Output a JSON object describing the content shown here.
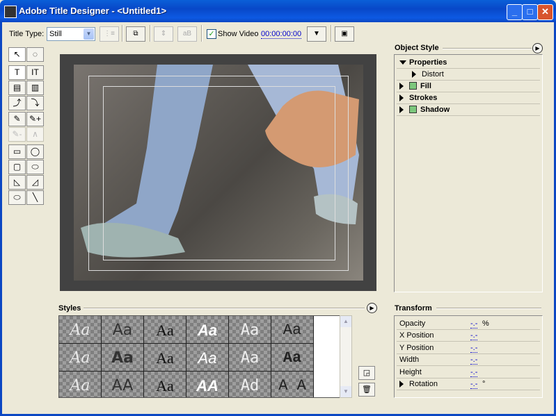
{
  "window": {
    "title": "Adobe Title Designer - <Untitled1>",
    "minimize": "_",
    "maximize": "□",
    "close": "✕"
  },
  "toolbar": {
    "title_type_label": "Title Type:",
    "title_type_value": "Still",
    "show_video_label": "Show Video",
    "show_video_checked": true,
    "timecode": "00:00:00:00"
  },
  "tools": [
    "↖",
    "◌",
    "T",
    "IT",
    "▤",
    "▥",
    "⤴",
    "⤵",
    "✎",
    "✎+",
    "✎-",
    "∧",
    "▭",
    "◯",
    "▢",
    "⬭",
    "◺",
    "◿",
    "⬭",
    "╲"
  ],
  "object_style": {
    "title": "Object Style",
    "rows": [
      {
        "label": "Properties",
        "expanded": true,
        "bold": true,
        "indent": 0,
        "swatch": false
      },
      {
        "label": "Distort",
        "expanded": false,
        "bold": false,
        "indent": 1,
        "swatch": false
      },
      {
        "label": "Fill",
        "expanded": false,
        "bold": true,
        "indent": 0,
        "swatch": true
      },
      {
        "label": "Strokes",
        "expanded": false,
        "bold": true,
        "indent": 0,
        "swatch": false
      },
      {
        "label": "Shadow",
        "expanded": false,
        "bold": true,
        "indent": 0,
        "swatch": true
      }
    ]
  },
  "styles": {
    "title": "Styles",
    "cells": [
      "Aa",
      "Aa",
      "Aa",
      "Aa",
      "Aa",
      "Aa",
      "Aa",
      "Aa",
      "Aa",
      "Aa",
      "Aa",
      "Aa",
      "Aa",
      "AA",
      "Aa",
      "AA",
      "Ad",
      "A A"
    ]
  },
  "transform": {
    "title": "Transform",
    "rows": [
      {
        "name": "Opacity",
        "value": "-.-",
        "unit": "%"
      },
      {
        "name": "X Position",
        "value": "-.-",
        "unit": ""
      },
      {
        "name": "Y Position",
        "value": "-.-",
        "unit": ""
      },
      {
        "name": "Width",
        "value": "-.-",
        "unit": ""
      },
      {
        "name": "Height",
        "value": "-.-",
        "unit": ""
      },
      {
        "name": "Rotation",
        "value": "-.-",
        "unit": "°"
      }
    ]
  }
}
